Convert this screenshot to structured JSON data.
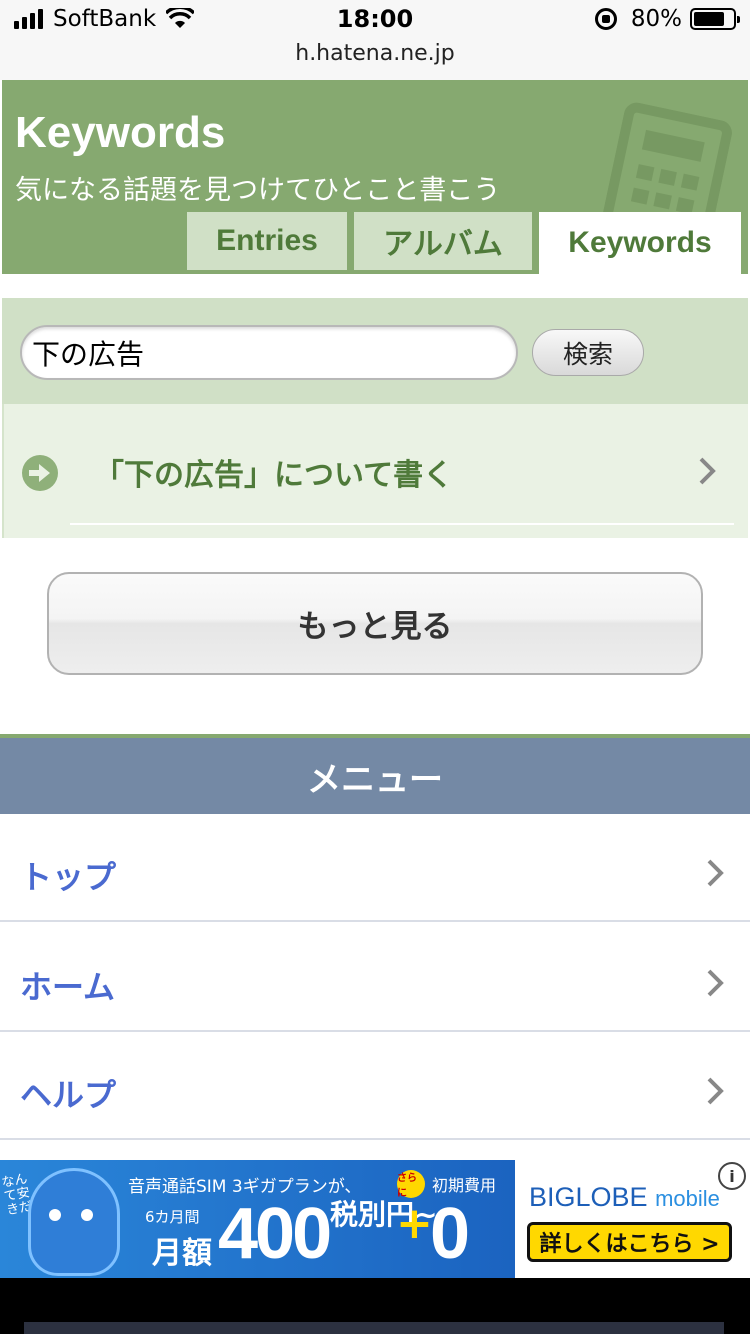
{
  "status_bar": {
    "carrier": "SoftBank",
    "time": "18:00",
    "url": "h.hatena.ne.jp",
    "battery_percent_text": "80%",
    "battery_level": 0.8
  },
  "header": {
    "title": "Keywords",
    "subtitle": "気になる話題を見つけてひとこと書こう",
    "background_color": "#86a970",
    "tabs": [
      {
        "label": "Entries",
        "active": false
      },
      {
        "label": "アルバム",
        "active": false
      },
      {
        "label": "Keywords",
        "active": true
      }
    ]
  },
  "search": {
    "query": "下の広告",
    "button_label": "検索"
  },
  "write_link": {
    "label": "「下の広告」について書く"
  },
  "more_button": {
    "label": "もっと見る"
  },
  "menu": {
    "title": "メニュー",
    "header_color": "#7489a5",
    "items": [
      {
        "label": "トップ"
      },
      {
        "label": "ホーム"
      },
      {
        "label": "ヘルプ"
      }
    ]
  },
  "ad": {
    "side_text": "なんて安きだ!",
    "line1": "音声通話SIM 3ギガプランが、",
    "badge": "さらに",
    "line1b": "初期費用",
    "six_months": "6カ月間",
    "monthly": "月額",
    "price": "400",
    "tax": "税別円~",
    "plus": "+",
    "zero": "0円",
    "brand": "BIGLOBE",
    "brand_suffix": "mobile",
    "cta": "詳しくはこちら >",
    "info": "i"
  }
}
